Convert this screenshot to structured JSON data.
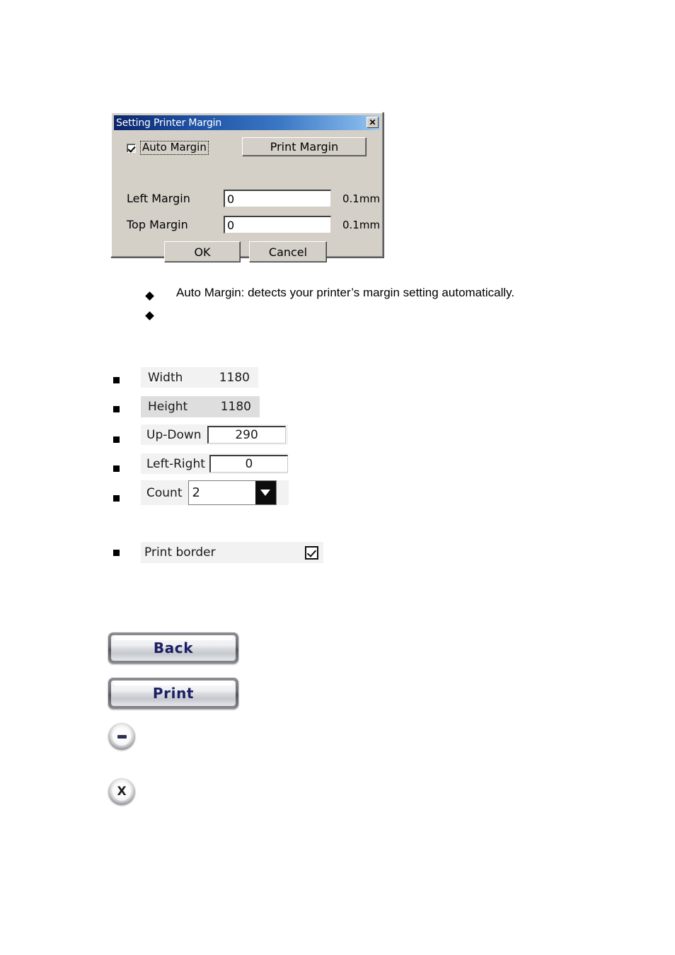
{
  "dialog": {
    "title": "Setting Printer Margin",
    "close_label": "✕",
    "auto_margin": {
      "label": "Auto Margin",
      "checked": true
    },
    "print_margin_button": "Print Margin",
    "fields": [
      {
        "label": "Left Margin",
        "value": "0",
        "unit": "0.1mm"
      },
      {
        "label": "Top Margin",
        "value": "0",
        "unit": "0.1mm"
      }
    ],
    "ok_label": "OK",
    "cancel_label": "Cancel"
  },
  "notes": [
    {
      "text": "Auto Margin: detects your printer’s margin setting automatically."
    },
    {
      "text": ""
    }
  ],
  "widgets": [
    {
      "kind": "flat",
      "label": "Width",
      "value": "1180"
    },
    {
      "kind": "flat",
      "label": "Height",
      "value": "1180"
    },
    {
      "kind": "input",
      "label": "Up-Down",
      "value": "290"
    },
    {
      "kind": "input",
      "label": "Left-Right",
      "value": "0"
    },
    {
      "kind": "combo",
      "label": "Count",
      "value": "2"
    }
  ],
  "print_border": {
    "label": "Print border",
    "checked": true
  },
  "action_buttons": [
    {
      "label": "Back"
    },
    {
      "label": "Print"
    }
  ],
  "icon_buttons": [
    {
      "name": "minimize",
      "glyph": "–"
    },
    {
      "name": "close",
      "glyph": "X"
    }
  ],
  "colors": {
    "title_bar_start": "#0a246a",
    "title_bar_end": "#a6cdf0",
    "dialog_face": "#d4d0c8",
    "button_text": "#1c1f63"
  }
}
